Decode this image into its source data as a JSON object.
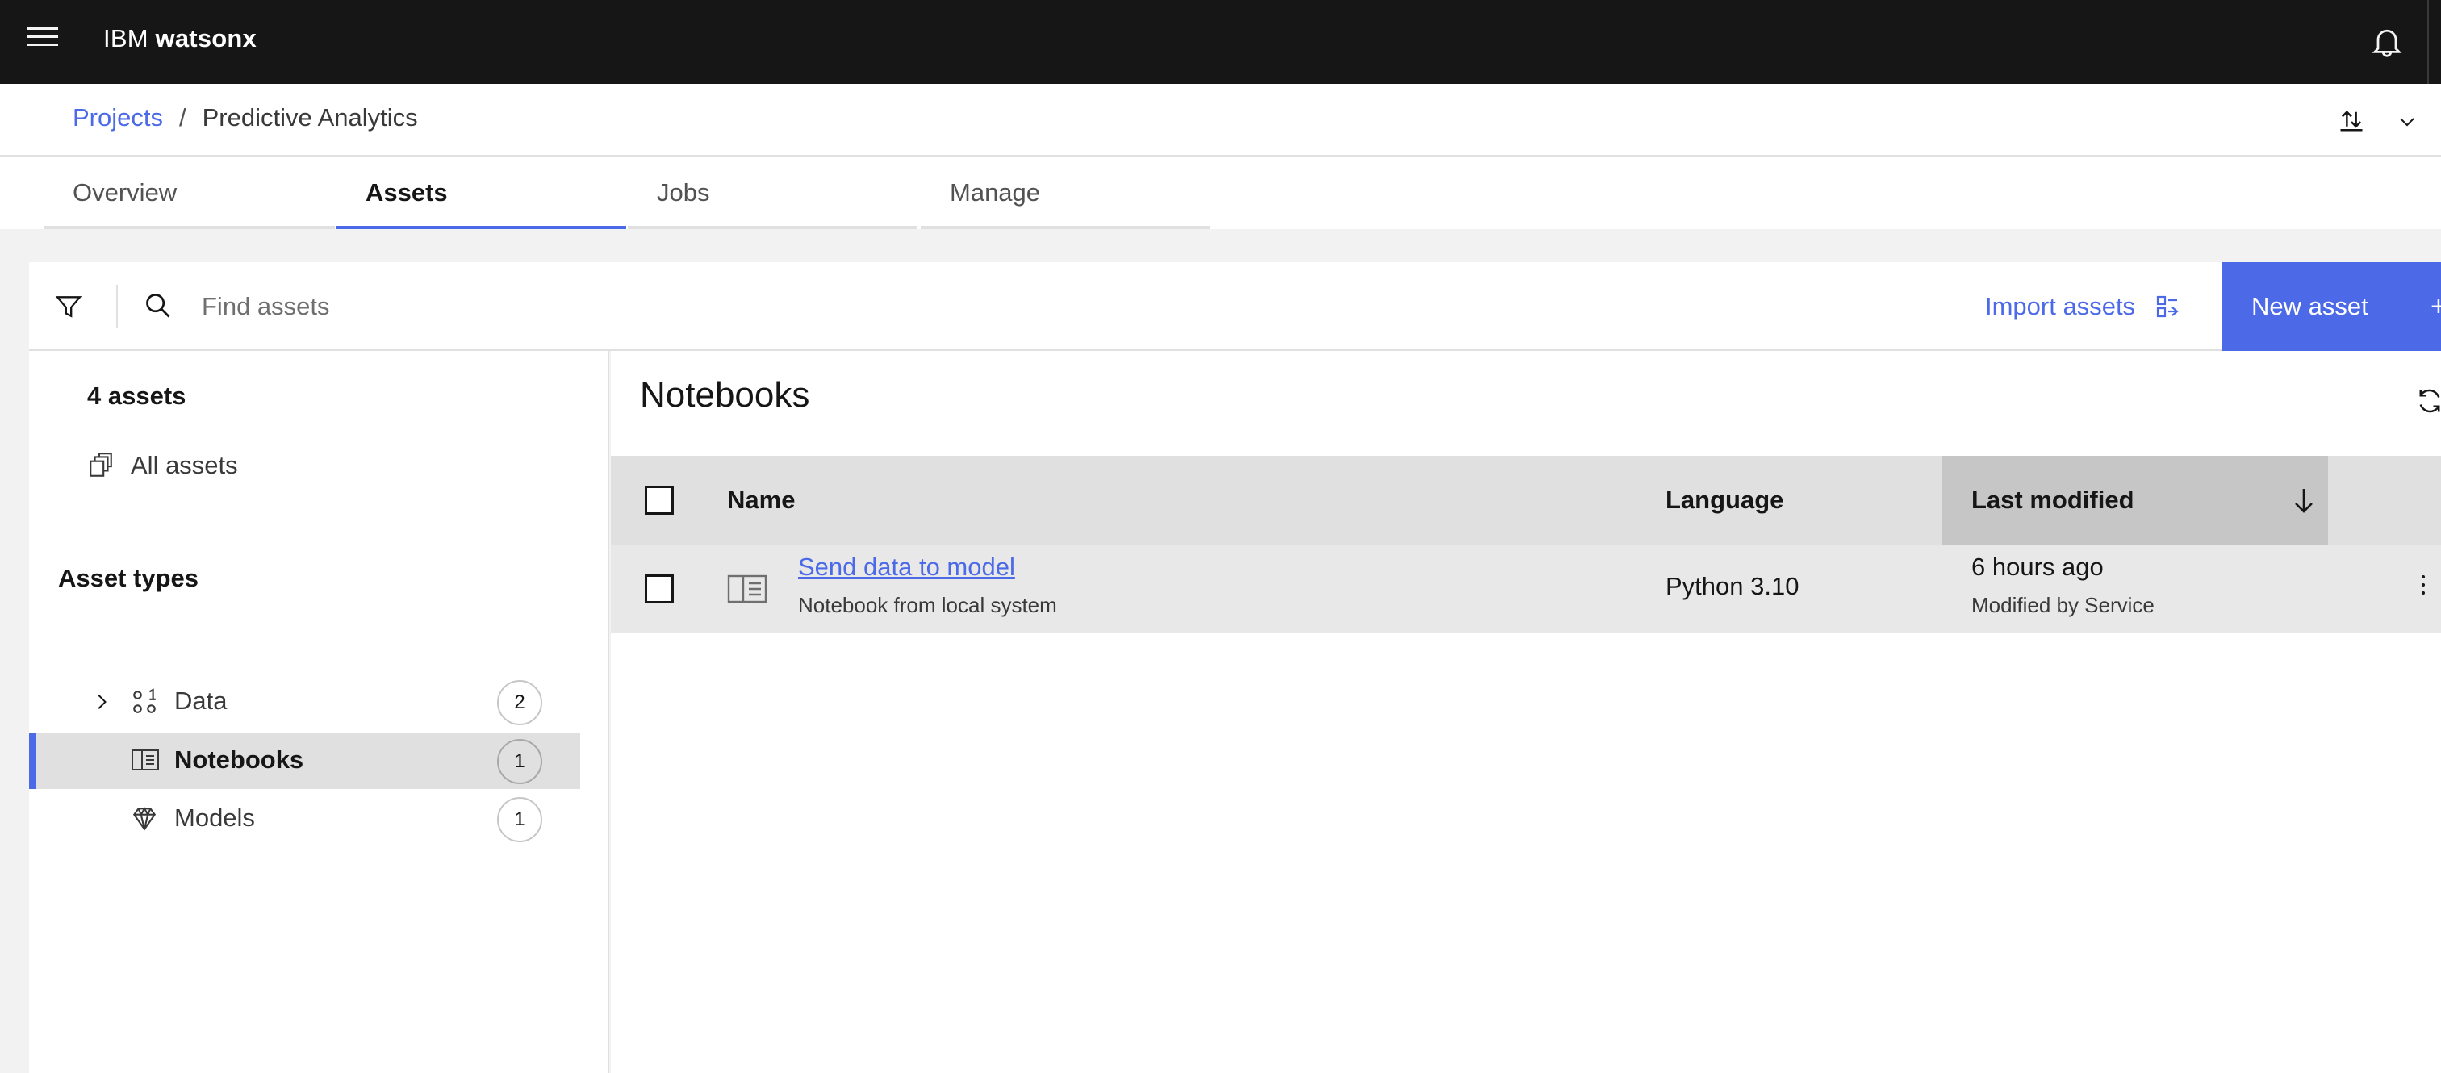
{
  "topbar": {
    "brand_prefix": "IBM",
    "brand_name": "watsonx",
    "menu_icon": "hamburger-menu-icon",
    "notifications_icon": "bell-icon"
  },
  "breadcrumb": {
    "projects_label": "Projects",
    "separator": "/",
    "current_label": "Predictive Analytics"
  },
  "header_actions": {
    "export_icon": "upload-download-icon",
    "expand_icon": "chevron-down-icon"
  },
  "tabs": [
    {
      "label": "Overview",
      "active": false
    },
    {
      "label": "Assets",
      "active": true
    },
    {
      "label": "Jobs",
      "active": false
    },
    {
      "label": "Manage",
      "active": false
    }
  ],
  "toolbar": {
    "search_placeholder": "Find assets",
    "import_label": "Import assets",
    "new_asset_label": "New asset"
  },
  "left_panel": {
    "asset_count": "4 assets",
    "all_assets_label": "All assets",
    "asset_types_title": "Asset types",
    "types": [
      {
        "label": "Data",
        "count": "2",
        "icon": "data-icon",
        "expandable": true,
        "selected": false
      },
      {
        "label": "Notebooks",
        "count": "1",
        "icon": "notebook-icon",
        "expandable": false,
        "selected": true
      },
      {
        "label": "Models",
        "count": "1",
        "icon": "model-diamond-icon",
        "expandable": false,
        "selected": false
      }
    ]
  },
  "main": {
    "title": "Notebooks",
    "columns": {
      "name": "Name",
      "language": "Language",
      "last_modified": "Last modified"
    },
    "sort": {
      "column": "last_modified",
      "direction": "descending"
    },
    "rows": [
      {
        "name": "Send data to model",
        "subtitle": "Notebook from local system",
        "language": "Python 3.10",
        "last_modified": "6 hours ago",
        "modified_by": "Modified by Service"
      }
    ]
  },
  "colors": {
    "accent": "#4c6ae8",
    "topbar_bg": "#161616",
    "page_bg": "#f2f2f2",
    "table_header_bg": "#e0e0e0",
    "sorted_header_bg": "#c6c6c6"
  }
}
